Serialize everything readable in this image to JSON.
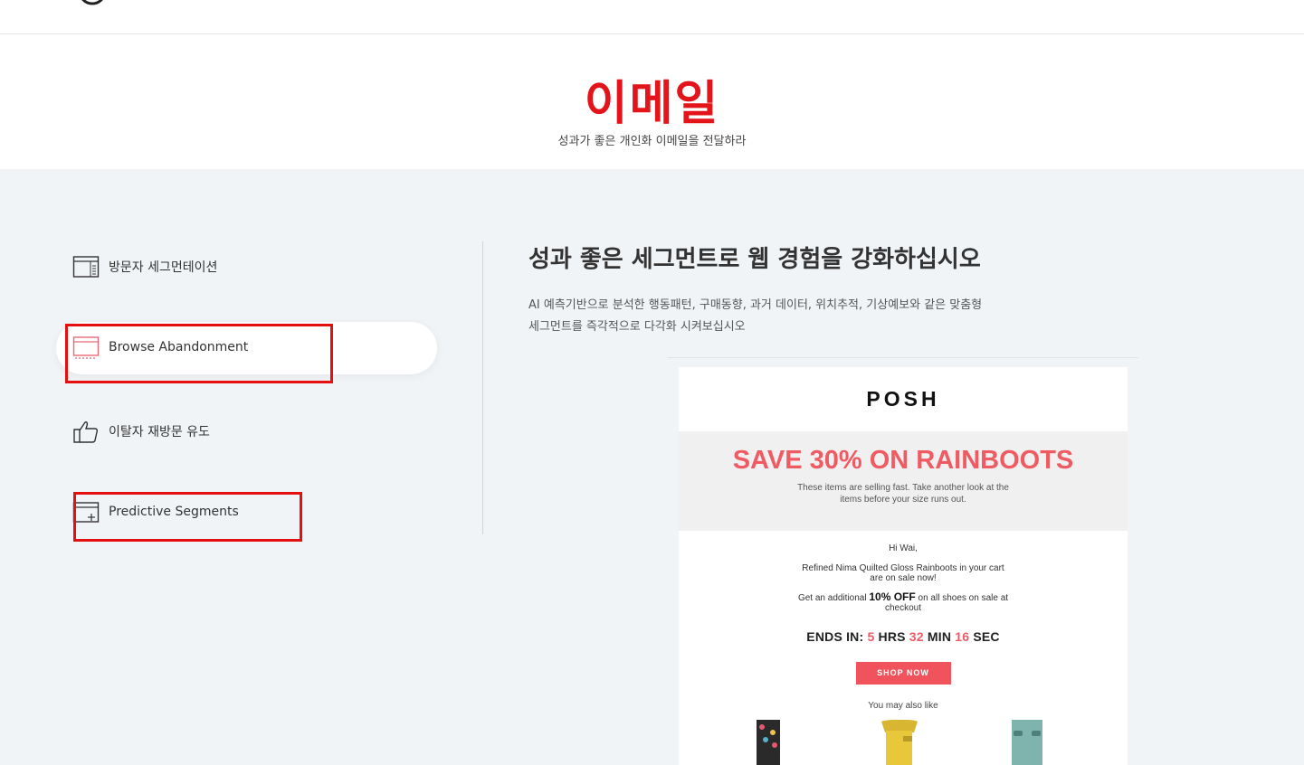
{
  "hero": {
    "title": "이메일",
    "subtitle": "성과가 좋은 개인화 이메일을 전달하라"
  },
  "menu": {
    "items": [
      {
        "label": "방문자 세그먼테이션",
        "icon": "browser-window-icon"
      },
      {
        "label": "Browse Abandonment",
        "icon": "browser-window-dotted-icon",
        "active": true
      },
      {
        "label": "이탈자 재방문 유도",
        "icon": "thumbs-up-icon"
      },
      {
        "label": "Predictive Segments",
        "icon": "browser-window-plus-icon"
      }
    ]
  },
  "content": {
    "title": "성과 좋은 세그먼트로 웹 경험을 강화하십시오",
    "description_line1": "AI 예측기반으로 분석한 행동패턴, 구매동향, 과거 데이터, 위치추적, 기상예보와 같은 맞춤형",
    "description_line2": "세그먼트를 즉각적으로 다각화 시켜보십시오"
  },
  "email": {
    "logo": "POSH",
    "banner_title": "SAVE 30% ON RAINBOOTS",
    "banner_sub": "These items are selling fast. Take another look at the items before your size runs out.",
    "greeting": "Hi Wai,",
    "cart_line": "Refined Nima Quilted Gloss Rainboots in your cart are on sale now!",
    "offer_pre": "Get an additional",
    "offer_bold": "10% OFF",
    "offer_post": "on all shoes on sale at checkout",
    "ends_label": "ENDS IN:",
    "hrs": "5",
    "hrs_label": "HRS",
    "min": "32",
    "min_label": "MIN",
    "sec": "16",
    "sec_label": "SEC",
    "shop_button": "SHOP NOW",
    "also_like": "You may also like"
  },
  "colors": {
    "brand_red": "#e4141b",
    "accent_coral": "#ef5b62",
    "highlight_box": "#e41010",
    "section_bg": "#f1f4f7"
  }
}
